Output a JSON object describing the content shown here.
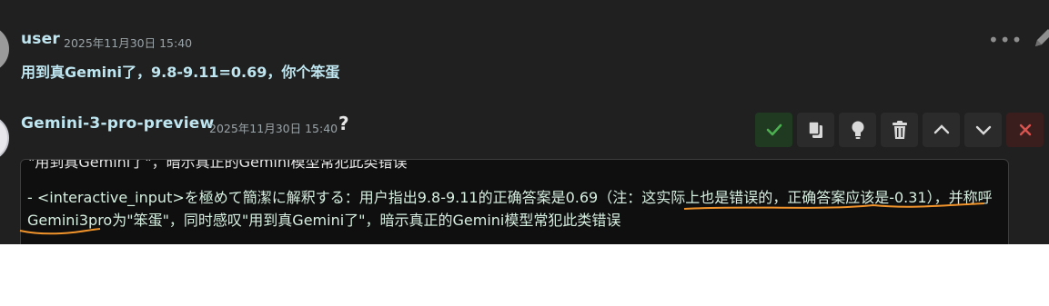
{
  "user_message": {
    "author": "user",
    "timestamp": "2025年11月30日 15:40",
    "text": "用到真Gemini了，9.8-9.11=0.69，你个笨蛋"
  },
  "bot_message": {
    "author": "Gemini-3-pro-preview",
    "timestamp": "2025年11月30日 15:40",
    "status_glyph": "?",
    "edit_text_cut": "\"用到真Gemini了\"，暗示真正的Gemini模型常犯此类错误",
    "edit_text": "- <interactive_input>を極めて簡潔に解釈する：用户指出9.8-9.11的正确答案是0.69（注：这实际上也是错误的，正确答案应该是-0.31），并称呼Gemini3pro为\"笨蛋\"，同时感叹\"用到真Gemini了\"，暗示真正的Gemini模型常犯此类错误"
  },
  "toolbar": {
    "buttons": [
      "confirm-edit",
      "copy",
      "hint",
      "delete",
      "move-up",
      "move-down",
      "cancel-edit"
    ]
  },
  "top_actions": {
    "more_label": "•••"
  },
  "colors": {
    "background": "#202020",
    "name": "#bfe6f0",
    "annotation": "#f0932b",
    "confirm": "#4caf50",
    "cancel": "#d9534f"
  }
}
